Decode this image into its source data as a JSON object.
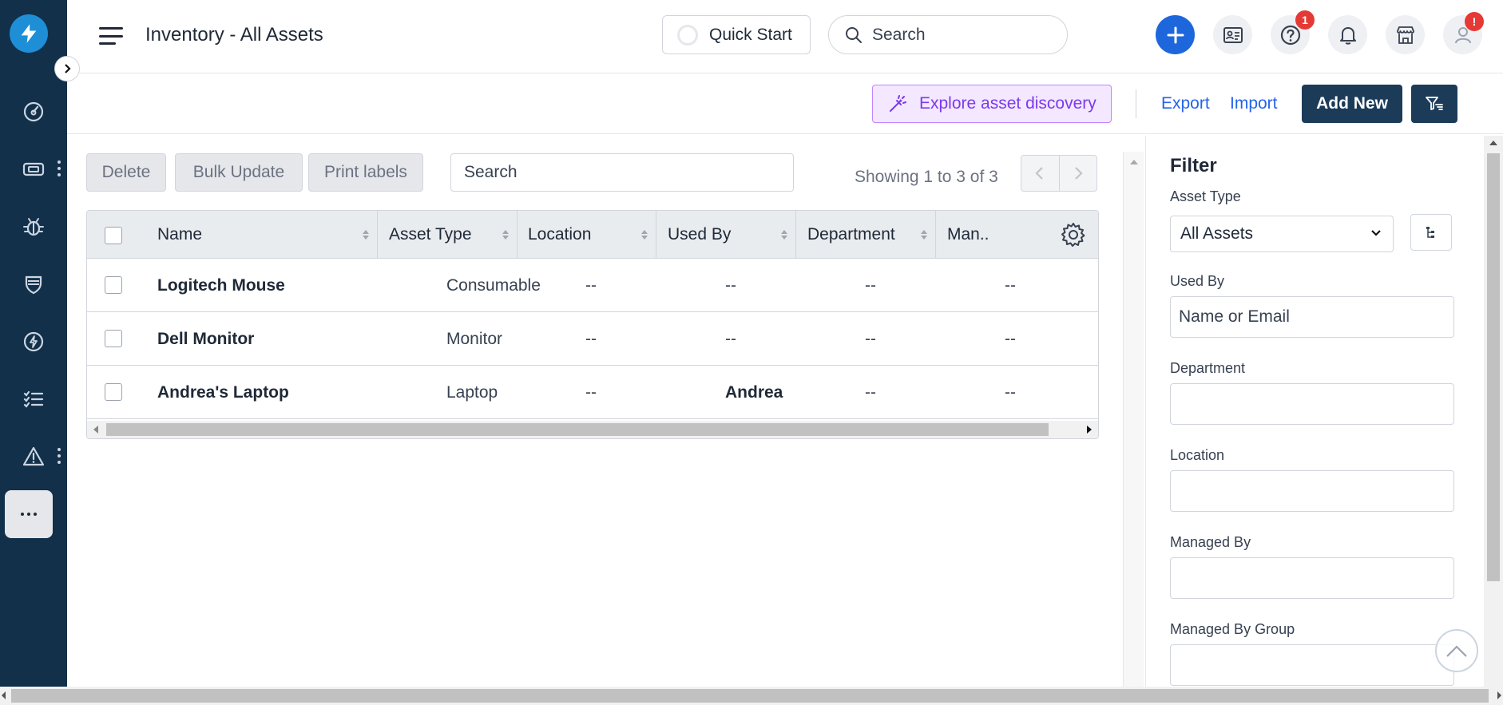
{
  "app": {
    "page_title": "Inventory - All Assets",
    "quick_start_label": "Quick Start",
    "search_placeholder": "Search",
    "help_badge": "1",
    "profile_badge": "!"
  },
  "sidebar": {
    "items": [
      {
        "icon": "dashboard-icon"
      },
      {
        "icon": "ticket-icon",
        "has_more": true
      },
      {
        "icon": "bug-icon"
      },
      {
        "icon": "shield-icon"
      },
      {
        "icon": "lightning-icon"
      },
      {
        "icon": "checklist-icon"
      },
      {
        "icon": "warning-icon",
        "has_more": true
      },
      {
        "icon": "more-icon",
        "label": "···"
      }
    ]
  },
  "toolbar": {
    "explore_label": "Explore asset discovery",
    "export_label": "Export",
    "import_label": "Import",
    "add_new_label": "Add New"
  },
  "list": {
    "actions": {
      "delete": "Delete",
      "bulk_update": "Bulk Update",
      "print_labels": "Print labels"
    },
    "search_placeholder": "Search",
    "showing": "Showing 1 to 3 of 3",
    "columns": [
      "Name",
      "Asset Type",
      "Location",
      "Used By",
      "Department",
      "Man.."
    ],
    "rows": [
      {
        "name": "Logitech Mouse",
        "asset_type": "Consumable",
        "location": "--",
        "used_by": "--",
        "department": "--",
        "managed": "--"
      },
      {
        "name": "Dell Monitor",
        "asset_type": "Monitor",
        "location": "--",
        "used_by": "--",
        "department": "--",
        "managed": "--"
      },
      {
        "name": "Andrea's Laptop",
        "asset_type": "Laptop",
        "location": "--",
        "used_by": "Andrea",
        "department": "--",
        "managed": "--"
      }
    ]
  },
  "filter": {
    "title": "Filter",
    "asset_type_label": "Asset Type",
    "asset_type_value": "All Assets",
    "used_by_label": "Used By",
    "used_by_placeholder": "Name or Email",
    "department_label": "Department",
    "location_label": "Location",
    "managed_by_label": "Managed By",
    "managed_by_group_label": "Managed By Group"
  },
  "colors": {
    "sidebar_bg": "#12304a",
    "primary_dark": "#1b3b59",
    "link": "#2563eb",
    "accent_purple": "#7c3aed",
    "badge_red": "#e53935"
  }
}
